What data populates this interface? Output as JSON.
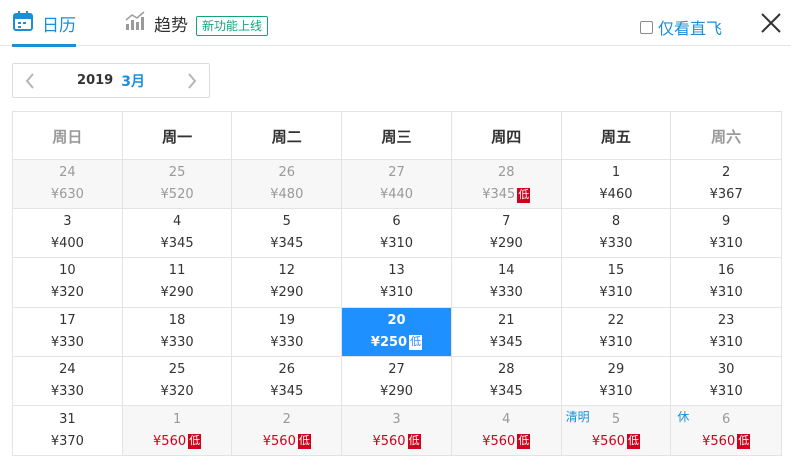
{
  "header": {
    "tab_calendar": "日历",
    "tab_trend": "趋势",
    "new_badge": "新功能上线",
    "direct_label": "仅看直飞"
  },
  "month_bar": {
    "year": "2019",
    "month": "3月"
  },
  "weekdays": [
    "周日",
    "周一",
    "周二",
    "周三",
    "周四",
    "周五",
    "周六"
  ],
  "weeks": [
    [
      {
        "date": "24",
        "price": "¥630",
        "state": "past"
      },
      {
        "date": "25",
        "price": "¥520",
        "state": "past"
      },
      {
        "date": "26",
        "price": "¥480",
        "state": "past"
      },
      {
        "date": "27",
        "price": "¥440",
        "state": "past"
      },
      {
        "date": "28",
        "price": "¥345",
        "state": "past",
        "low": "低"
      },
      {
        "date": "1",
        "price": "¥460"
      },
      {
        "date": "2",
        "price": "¥367"
      }
    ],
    [
      {
        "date": "3",
        "price": "¥400"
      },
      {
        "date": "4",
        "price": "¥345"
      },
      {
        "date": "5",
        "price": "¥345"
      },
      {
        "date": "6",
        "price": "¥310"
      },
      {
        "date": "7",
        "price": "¥290"
      },
      {
        "date": "8",
        "price": "¥330"
      },
      {
        "date": "9",
        "price": "¥310"
      }
    ],
    [
      {
        "date": "10",
        "price": "¥320"
      },
      {
        "date": "11",
        "price": "¥290"
      },
      {
        "date": "12",
        "price": "¥290"
      },
      {
        "date": "13",
        "price": "¥310"
      },
      {
        "date": "14",
        "price": "¥330"
      },
      {
        "date": "15",
        "price": "¥310"
      },
      {
        "date": "16",
        "price": "¥310"
      }
    ],
    [
      {
        "date": "17",
        "price": "¥330"
      },
      {
        "date": "18",
        "price": "¥330"
      },
      {
        "date": "19",
        "price": "¥330"
      },
      {
        "date": "20",
        "price": "¥250",
        "state": "selected",
        "low": "低"
      },
      {
        "date": "21",
        "price": "¥345"
      },
      {
        "date": "22",
        "price": "¥310"
      },
      {
        "date": "23",
        "price": "¥310"
      }
    ],
    [
      {
        "date": "24",
        "price": "¥330"
      },
      {
        "date": "25",
        "price": "¥320"
      },
      {
        "date": "26",
        "price": "¥345"
      },
      {
        "date": "27",
        "price": "¥290"
      },
      {
        "date": "28",
        "price": "¥345"
      },
      {
        "date": "29",
        "price": "¥310"
      },
      {
        "date": "30",
        "price": "¥310"
      }
    ],
    [
      {
        "date": "31",
        "price": "¥370"
      },
      {
        "date": "1",
        "price": "¥560",
        "state": "next",
        "low": "低"
      },
      {
        "date": "2",
        "price": "¥560",
        "state": "next",
        "low": "低"
      },
      {
        "date": "3",
        "price": "¥560",
        "state": "next",
        "low": "低"
      },
      {
        "date": "4",
        "price": "¥560",
        "state": "next",
        "low": "低"
      },
      {
        "date": "5",
        "price": "¥560",
        "state": "next",
        "low": "低",
        "holiday": "清明"
      },
      {
        "date": "6",
        "price": "¥560",
        "state": "next",
        "low": "低",
        "rest": "休"
      }
    ]
  ],
  "colors": {
    "accent": "#1a8fd8",
    "selected": "#1e90ff",
    "low_price": "#d0021b",
    "badge": "#15a27d"
  }
}
